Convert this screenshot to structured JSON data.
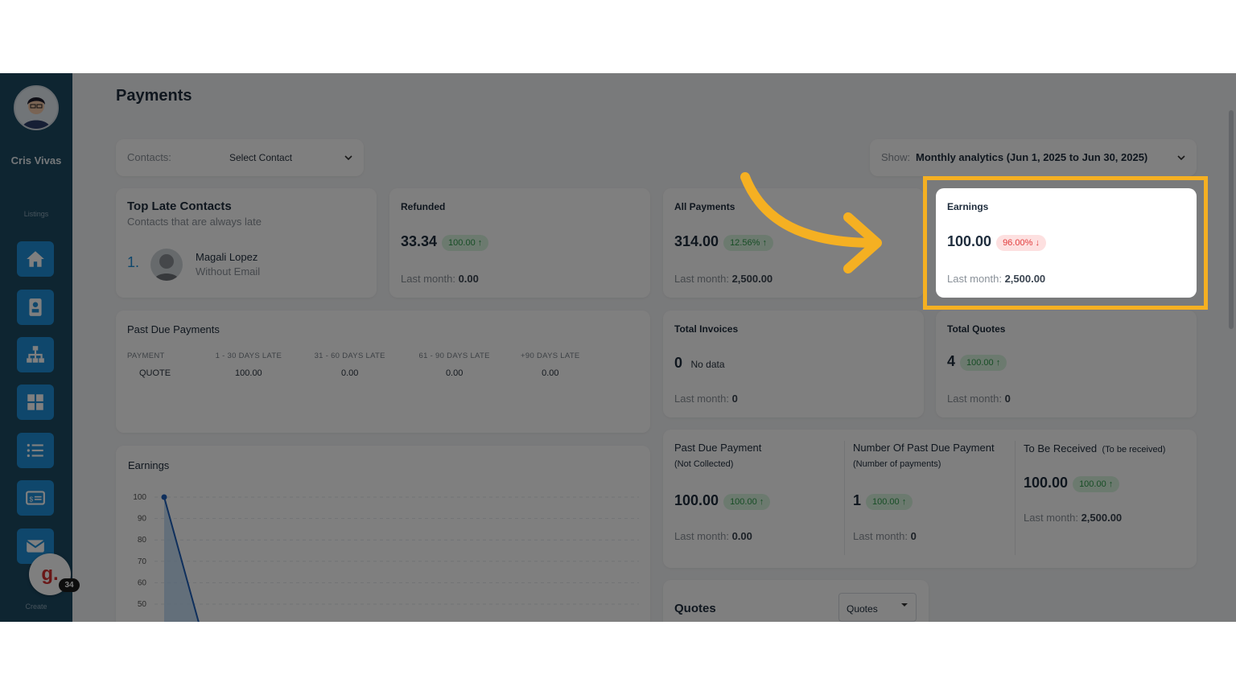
{
  "user": {
    "name": "Cris Vivas"
  },
  "sidebar": {
    "listings_label": "Listings",
    "create_label": "Create",
    "nav": [
      {
        "icon": "home-icon"
      },
      {
        "icon": "contact-card-icon"
      },
      {
        "icon": "sitemap-icon"
      },
      {
        "icon": "grid-icon"
      },
      {
        "icon": "list-icon"
      },
      {
        "icon": "invoice-icon"
      },
      {
        "icon": "mail-icon"
      }
    ],
    "badge_letter": "g.",
    "badge_count": "34"
  },
  "page": {
    "title": "Payments"
  },
  "filters": {
    "contacts_label": "Contacts:",
    "contacts_value": "Select Contact",
    "show_label": "Show:",
    "show_value": "Monthly analytics (Jun 1, 2025 to Jun 30, 2025)"
  },
  "top_late": {
    "title": "Top Late Contacts",
    "subtitle": "Contacts that are always late",
    "rank": "1.",
    "name": "Magali Lopez",
    "email": "Without Email"
  },
  "refunded": {
    "title": "Refunded",
    "value": "33.34",
    "pill": "100.00",
    "arrow": "↑",
    "last_label": "Last month:",
    "last_value": "0.00"
  },
  "all_payments": {
    "title": "All Payments",
    "value": "314.00",
    "pill": "12.56%",
    "arrow": "↑",
    "last_label": "Last month:",
    "last_value": "2,500.00"
  },
  "earnings_card": {
    "title": "Earnings",
    "value": "100.00",
    "pill": "96.00%",
    "arrow": "↓",
    "last_label": "Last month:",
    "last_value": "2,500.00"
  },
  "past_due": {
    "title": "Past Due Payments",
    "headers": [
      "PAYMENT",
      "1 - 30 DAYS LATE",
      "31 - 60 DAYS LATE",
      "61 - 90 DAYS LATE",
      "+90 DAYS LATE"
    ],
    "rows": [
      [
        "QUOTE",
        "100.00",
        "0.00",
        "0.00",
        "0.00"
      ]
    ]
  },
  "total_invoices": {
    "title": "Total Invoices",
    "value": "0",
    "note": "No data",
    "last_label": "Last month:",
    "last_value": "0"
  },
  "total_quotes": {
    "title": "Total Quotes",
    "value": "4",
    "pill": "100.00",
    "arrow": "↑",
    "last_label": "Last month:",
    "last_value": "0"
  },
  "summary": [
    {
      "title": "Past Due Payment",
      "subtitle": "(Not Collected)",
      "value": "100.00",
      "pill": "100.00",
      "arrow": "↑",
      "last_label": "Last month:",
      "last_value": "0.00"
    },
    {
      "title": "Number Of Past Due Payment",
      "subtitle": "(Number of payments)",
      "value": "1",
      "pill": "100.00",
      "arrow": "↑",
      "last_label": "Last month:",
      "last_value": "0"
    },
    {
      "title": "To Be Received",
      "subtitle": "(To be received)",
      "value": "100.00",
      "pill": "100.00",
      "arrow": "↑",
      "last_label": "Last month:",
      "last_value": "2,500.00"
    }
  ],
  "quotes_section": {
    "title": "Quotes",
    "dropdown": "Quotes"
  },
  "colors": {
    "accent": "#f5b022",
    "sidebar": "#1c4a63",
    "nav_button": "#1e8fd8",
    "positive": "#2f9a4b",
    "negative": "#e23b3b"
  },
  "chart_data": {
    "type": "area",
    "title": "Earnings",
    "yticks": [
      100,
      90,
      80,
      70,
      60,
      50
    ],
    "ylim": [
      50,
      100
    ],
    "series": [
      {
        "values": [
          100,
          40
        ]
      }
    ],
    "grid": true
  }
}
